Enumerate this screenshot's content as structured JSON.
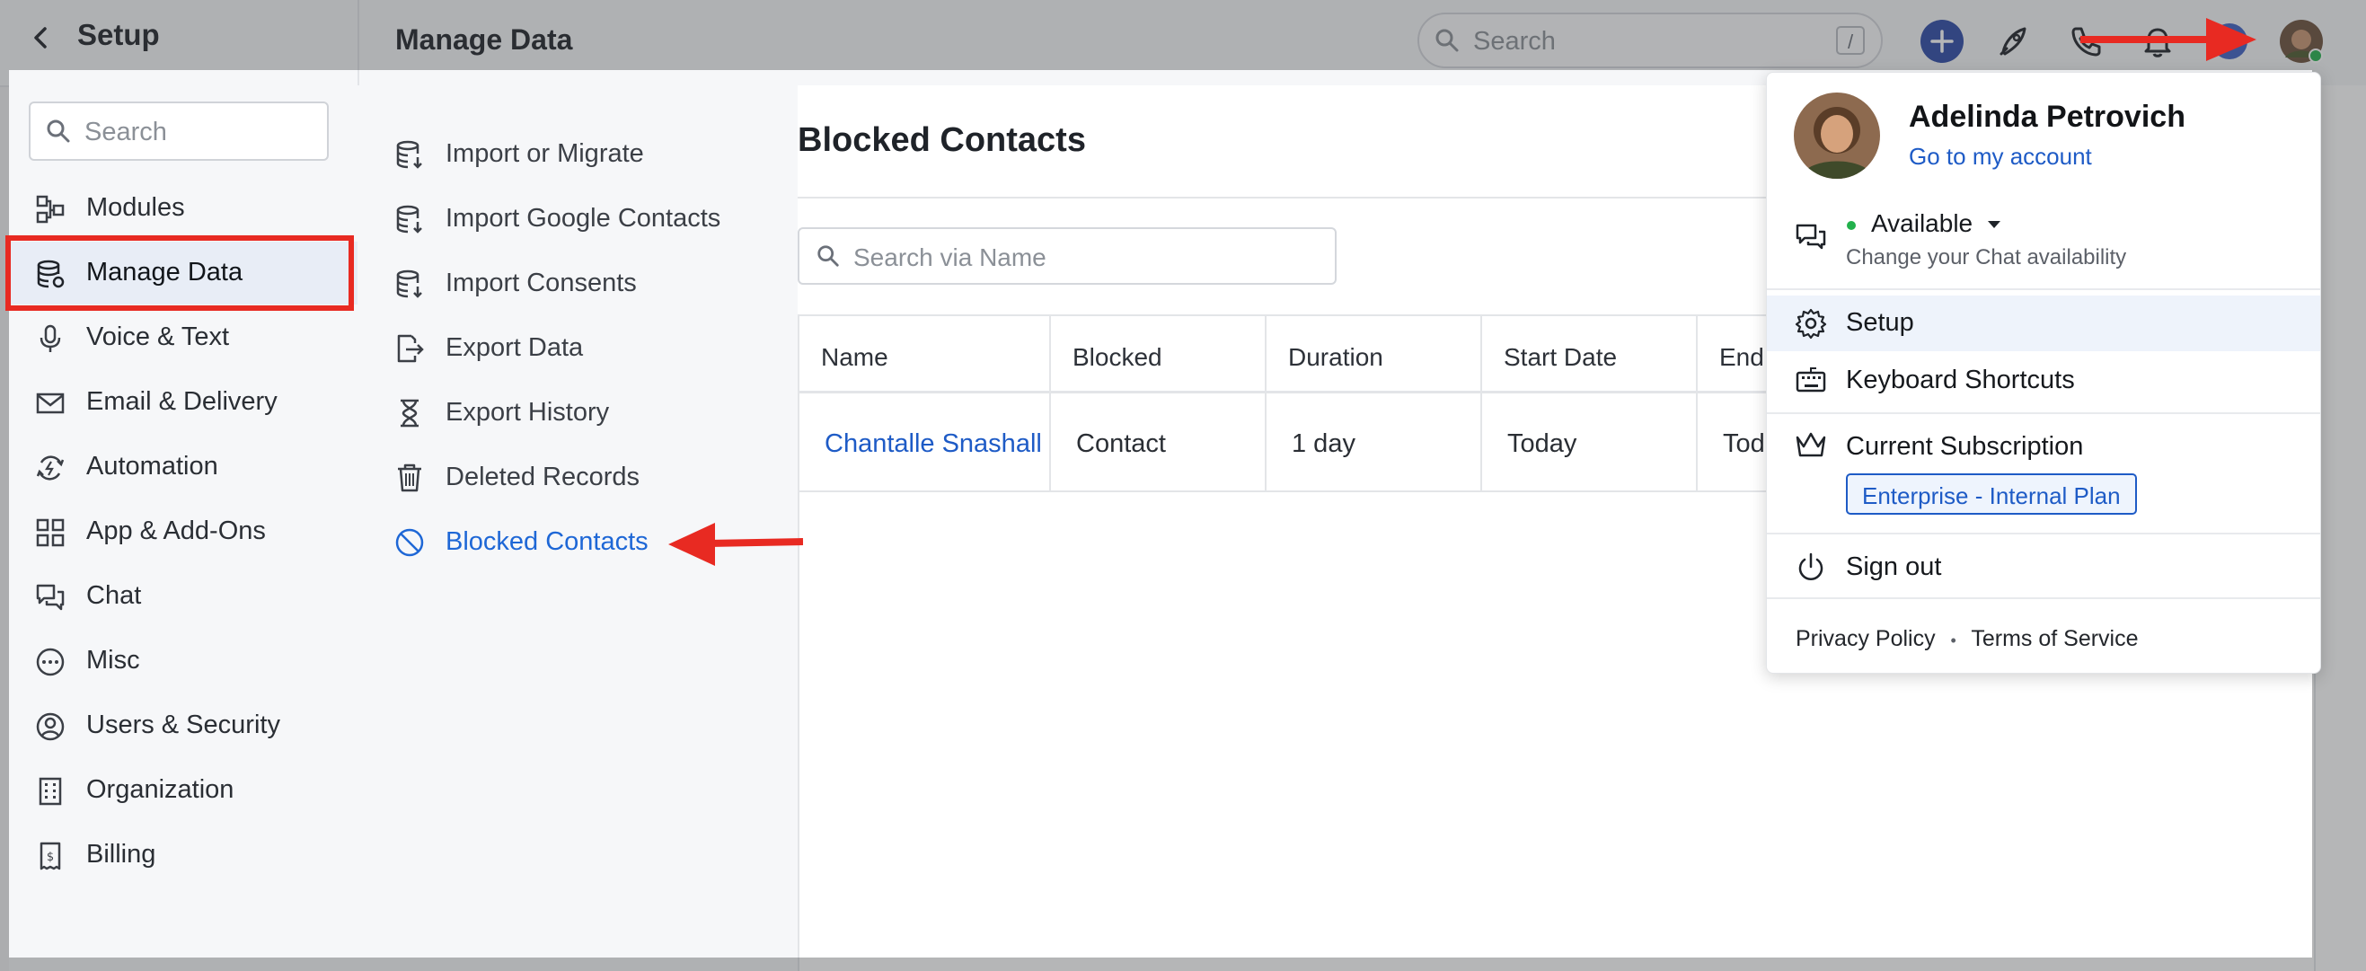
{
  "header": {
    "back_icon": "chevron-left-icon",
    "setup_title": "Setup",
    "page_title": "Manage Data",
    "search_placeholder": "Search",
    "search_shortcut": "/"
  },
  "sidebar": {
    "search_placeholder": "Search",
    "items": [
      {
        "label": "Modules",
        "icon": "modules-icon"
      },
      {
        "label": "Manage Data",
        "icon": "database-icon"
      },
      {
        "label": "Voice & Text",
        "icon": "microphone-icon"
      },
      {
        "label": "Email & Delivery",
        "icon": "envelope-icon"
      },
      {
        "label": "Automation",
        "icon": "automation-icon"
      },
      {
        "label": "App & Add-Ons",
        "icon": "apps-grid-icon"
      },
      {
        "label": "Chat",
        "icon": "chat-icon"
      },
      {
        "label": "Misc",
        "icon": "more-icon"
      },
      {
        "label": "Users & Security",
        "icon": "user-circle-icon"
      },
      {
        "label": "Organization",
        "icon": "building-icon"
      },
      {
        "label": "Billing",
        "icon": "receipt-icon"
      }
    ]
  },
  "submenu": {
    "items": [
      {
        "label": "Import or Migrate",
        "icon": "database-import-icon"
      },
      {
        "label": "Import Google Contacts",
        "icon": "database-import-icon"
      },
      {
        "label": "Import Consents",
        "icon": "database-import-icon"
      },
      {
        "label": "Export Data",
        "icon": "export-icon"
      },
      {
        "label": "Export History",
        "icon": "hourglass-icon"
      },
      {
        "label": "Deleted Records",
        "icon": "trash-icon"
      },
      {
        "label": "Blocked Contacts",
        "icon": "blocked-icon"
      }
    ]
  },
  "main": {
    "title": "Blocked Contacts",
    "search_placeholder": "Search via Name",
    "columns": [
      "Name",
      "Blocked",
      "Duration",
      "Start Date",
      "End"
    ],
    "rows": [
      [
        "Chantalle Snashall",
        "Contact",
        "1 day",
        "Today",
        "Tod"
      ]
    ]
  },
  "account_menu": {
    "user_name": "Adelinda Petrovich",
    "account_link": "Go to my account",
    "status": "Available",
    "status_color": "#22b14c",
    "status_hint": "Change your Chat availability",
    "setup": "Setup",
    "shortcuts": "Keyboard Shortcuts",
    "subscription": "Current Subscription",
    "plan": "Enterprise - Internal Plan",
    "sign_out": "Sign out",
    "privacy": "Privacy Policy",
    "separator": "•",
    "terms": "Terms of Service"
  },
  "colors": {
    "accent": "#1e5bc6",
    "annotation_red": "#e82a22",
    "add_button": "#2c4aa6"
  }
}
